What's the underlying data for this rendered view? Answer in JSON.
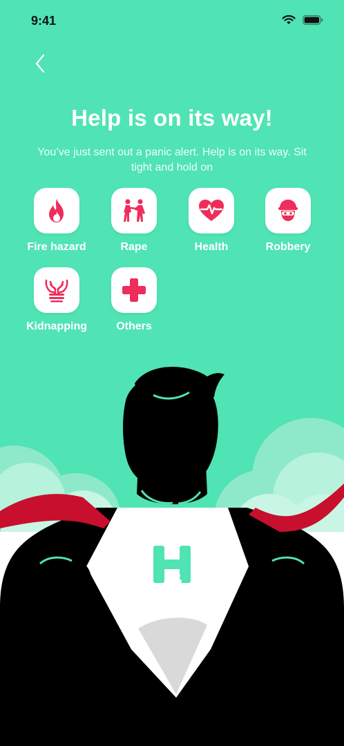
{
  "status_bar": {
    "time": "9:41",
    "icons": [
      "signal-icon",
      "wifi-icon",
      "battery-icon"
    ]
  },
  "header": {
    "back_icon": "chevron-left-icon"
  },
  "alert": {
    "title": "Help is on its way!",
    "message": "You’ve just sent out a panic alert. Help is on its way. Sit tight and hold on"
  },
  "categories": [
    {
      "label": "Fire hazard",
      "icon": "fire-icon"
    },
    {
      "label": "Rape",
      "icon": "people-icon"
    },
    {
      "label": "Health",
      "icon": "heart-pulse-icon"
    },
    {
      "label": "Robbery",
      "icon": "robber-icon"
    },
    {
      "label": "Kidnapping",
      "icon": "bound-hands-icon"
    },
    {
      "label": "Others",
      "icon": "plus-icon"
    }
  ],
  "colors": {
    "background": "#50e3b4",
    "accent": "#ee2d5a",
    "cape": "#c8102e"
  }
}
